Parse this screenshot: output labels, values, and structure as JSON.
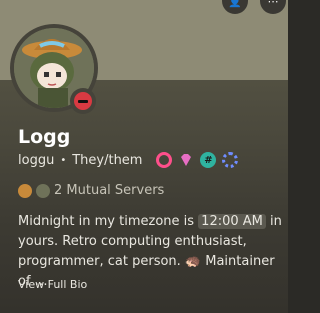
{
  "profile": {
    "display_name": "Logg",
    "username": "loggu",
    "pronouns": "They/them",
    "separator": "•",
    "status": "do-not-disturb"
  },
  "badges": [
    {
      "name": "nitro-badge-icon",
      "color": "#ff4f8b"
    },
    {
      "name": "gem-badge-icon",
      "color": "#e76ec4"
    },
    {
      "name": "hash-badge-icon",
      "color": "#2fb3a0",
      "glyph": "#"
    },
    {
      "name": "gear-badge-icon",
      "color": "#6f8cff"
    }
  ],
  "mutual": {
    "label": "2 Mutual Servers"
  },
  "bio": {
    "part1": "Midnight in my timezone is ",
    "timestamp": "12:00 AM",
    "part2": " in yours. Retro computing enthusiast, programmer, cat person. 🦔 Maintainer of …"
  },
  "actions": {
    "view_full_bio": "View Full Bio"
  },
  "colors": {
    "banner": "#8e8b75",
    "status_dnd": "#d83a42"
  }
}
